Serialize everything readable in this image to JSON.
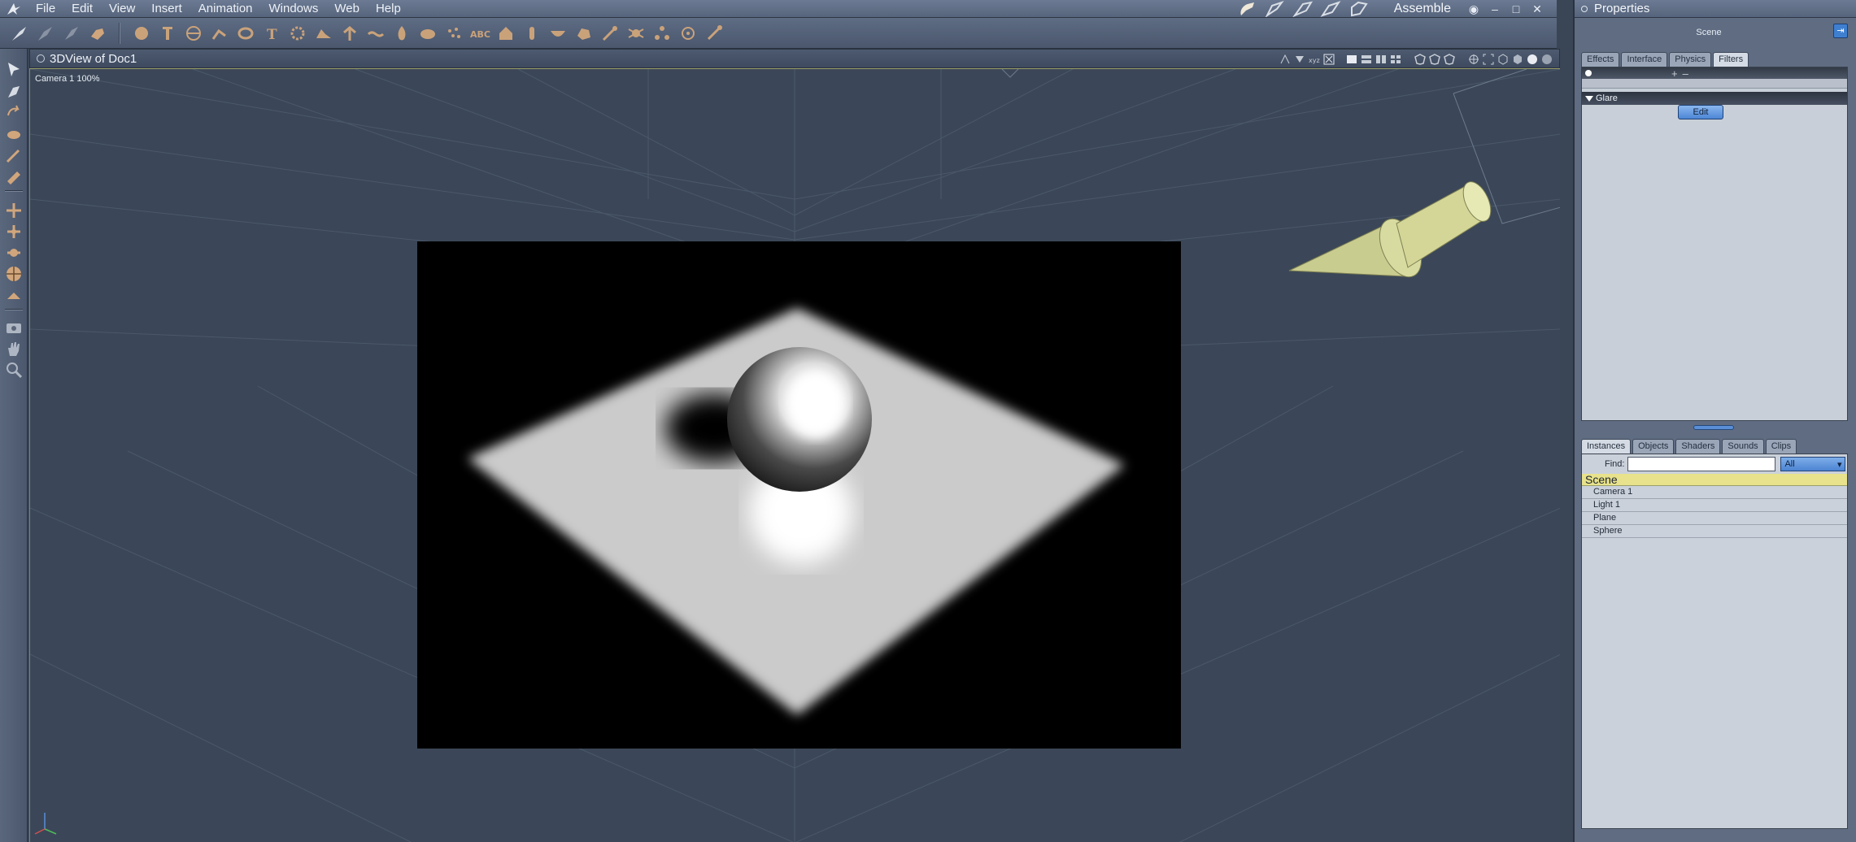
{
  "menubar": {
    "items": [
      "File",
      "Edit",
      "View",
      "Insert",
      "Animation",
      "Windows",
      "Web",
      "Help"
    ],
    "room": "Assemble"
  },
  "viewport": {
    "title": "3DView of Doc1",
    "camera_label": "Camera 1 100%"
  },
  "properties": {
    "title": "Properties",
    "scene_label": "Scene",
    "tabs": [
      "Effects",
      "Interface",
      "Physics",
      "Filters"
    ],
    "active_tab": "Filters",
    "filter_name": "Glare",
    "edit_label": "Edit"
  },
  "instances": {
    "tabs": [
      "Instances",
      "Objects",
      "Shaders",
      "Sounds",
      "Clips"
    ],
    "active_tab": "Instances",
    "find_label": "Find:",
    "find_value": "",
    "filter_value": "All",
    "tree_root": "Scene",
    "items": [
      "Camera 1",
      "Light 1",
      "Plane",
      "Sphere"
    ]
  },
  "colors": {
    "accent_blue": "#4d86d6",
    "highlight_yellow": "#e7e28b",
    "viewport_bg": "#3b4758",
    "light_object": "#cfd197"
  }
}
